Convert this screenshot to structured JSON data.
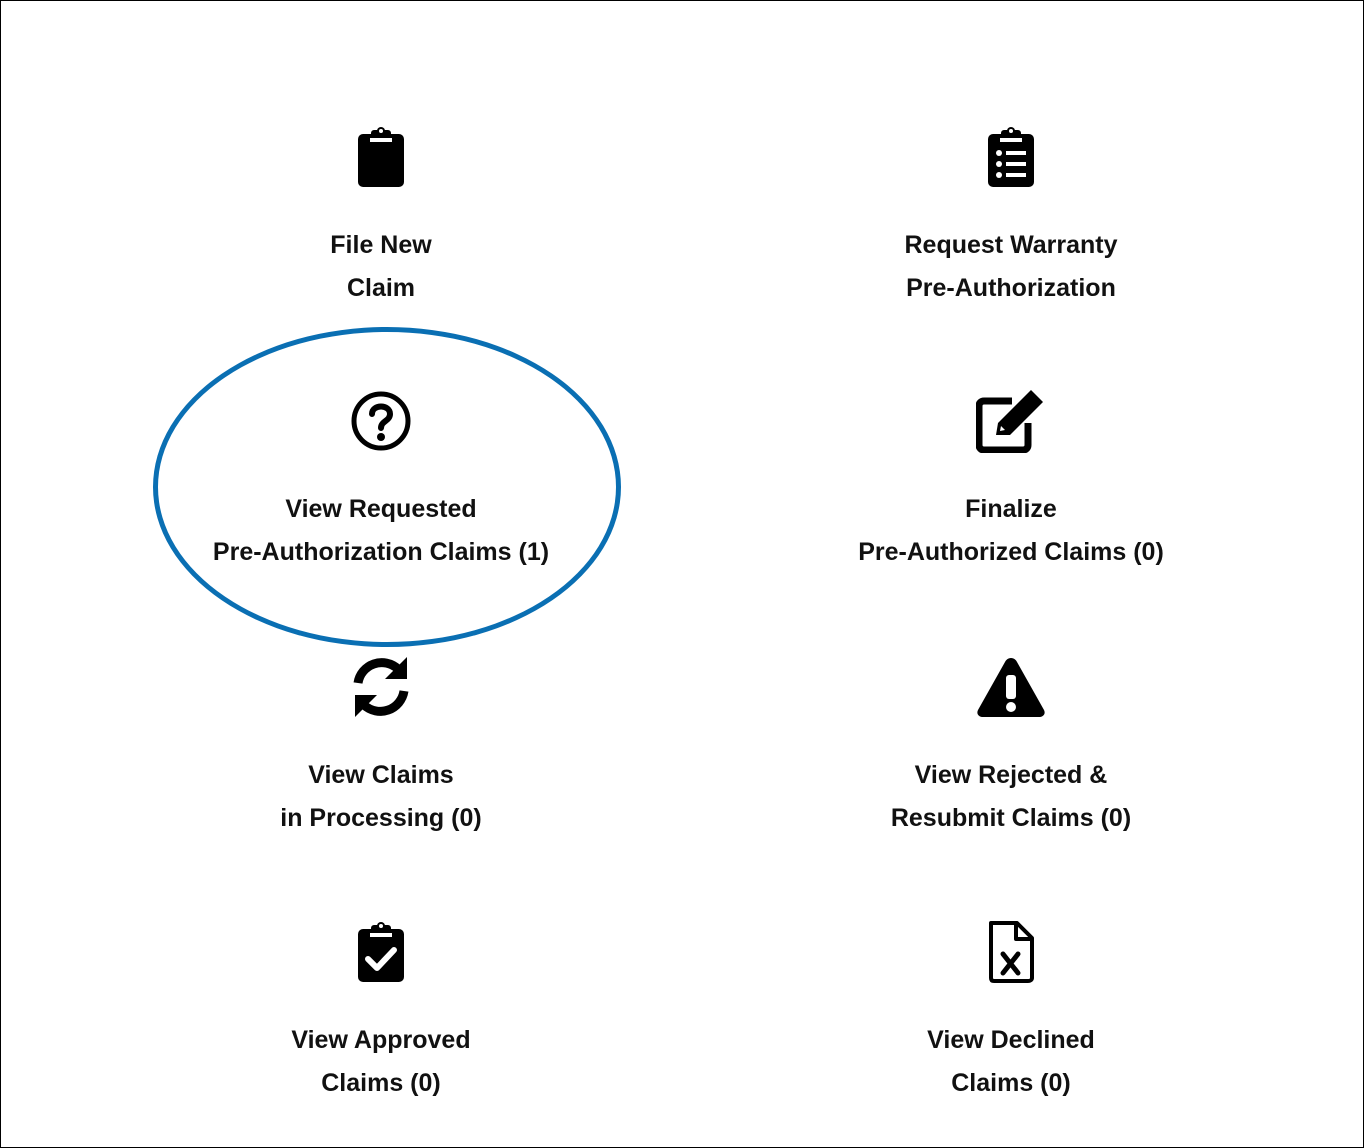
{
  "tiles": [
    {
      "id": "file-new-claim",
      "icon": "clipboard-icon",
      "line1": "File New",
      "line2": "Claim"
    },
    {
      "id": "request-warranty",
      "icon": "clipboard-list-icon",
      "line1": "Request Warranty",
      "line2": "Pre-Authorization"
    },
    {
      "id": "view-requested",
      "icon": "question-circle-icon",
      "line1": "View Requested",
      "line2": "Pre-Authorization Claims (1)"
    },
    {
      "id": "finalize",
      "icon": "edit-icon",
      "line1": "Finalize",
      "line2": "Pre-Authorized Claims (0)"
    },
    {
      "id": "in-processing",
      "icon": "sync-icon",
      "line1": "View Claims",
      "line2": "in Processing (0)"
    },
    {
      "id": "rejected",
      "icon": "warning-icon",
      "line1": "View Rejected &",
      "line2": "Resubmit Claims (0)"
    },
    {
      "id": "approved",
      "icon": "clipboard-check-icon",
      "line1": "View Approved",
      "line2": "Claims (0)"
    },
    {
      "id": "declined",
      "icon": "file-excel-icon",
      "line1": "View Declined",
      "line2": "Claims (0)"
    }
  ],
  "colors": {
    "highlight": "#0a6fb3",
    "text": "#111111",
    "icon": "#000000"
  }
}
